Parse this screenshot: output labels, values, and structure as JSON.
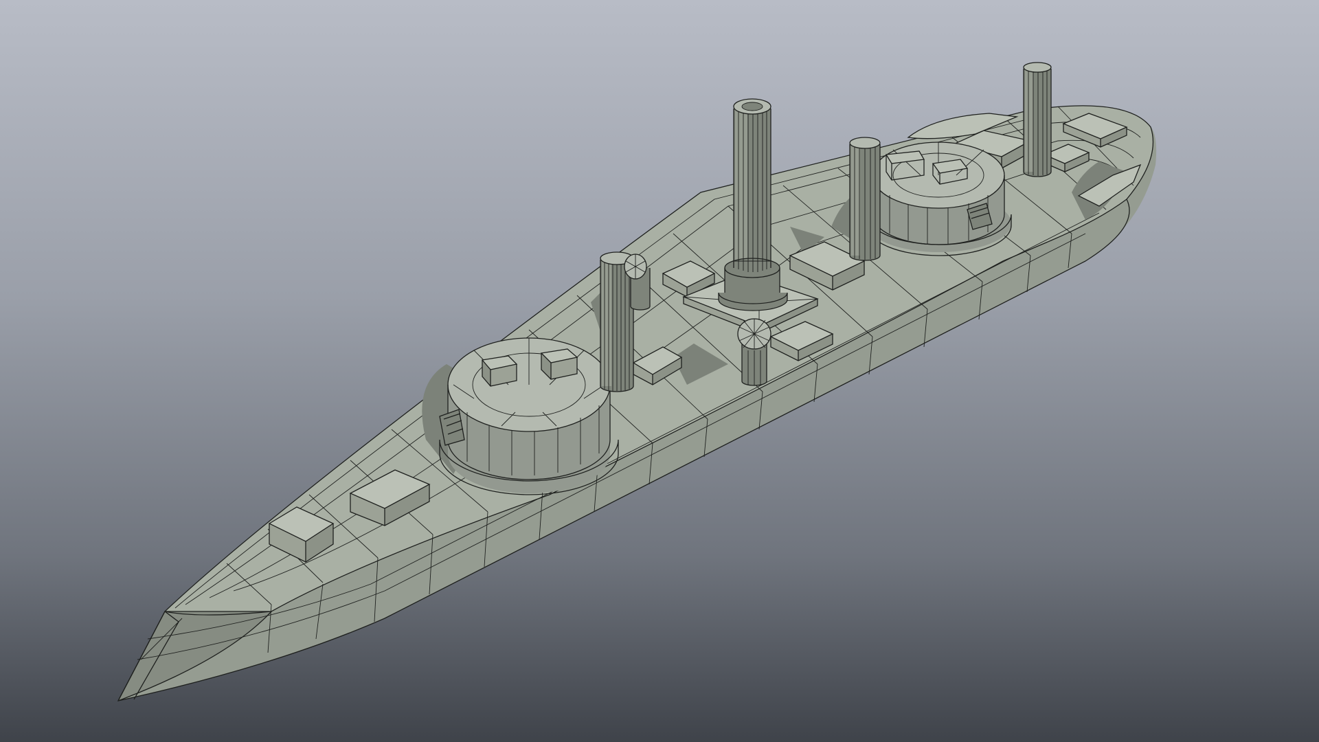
{
  "viewport": {
    "background_top": "#b8bcc6",
    "background_bottom": "#3f434a",
    "model_color": "#a9b0a4",
    "wireframe_color": "#1e201e"
  },
  "model": {
    "subject": "ironclad-warship",
    "turrets": 2,
    "smokestacks": 4,
    "ventilators": 2,
    "deck_boxes": 9
  }
}
